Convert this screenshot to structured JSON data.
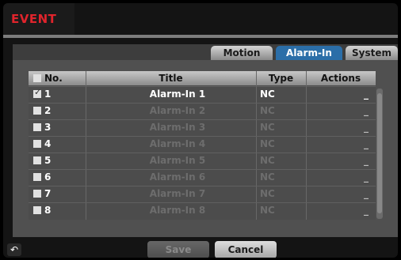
{
  "window": {
    "title": "EVENT"
  },
  "tabs": [
    {
      "label": "Motion"
    },
    {
      "label": "Alarm-In"
    },
    {
      "label": "System"
    }
  ],
  "table": {
    "headers": {
      "no": "No.",
      "title": "Title",
      "type": "Type",
      "actions": "Actions"
    },
    "rows": [
      {
        "no": "1",
        "title": "Alarm-In 1",
        "type": "NC"
      },
      {
        "no": "2",
        "title": "Alarm-In 2",
        "type": "NC"
      },
      {
        "no": "3",
        "title": "Alarm-In 3",
        "type": "NC"
      },
      {
        "no": "4",
        "title": "Alarm-In 4",
        "type": "NC"
      },
      {
        "no": "5",
        "title": "Alarm-In 5",
        "type": "NC"
      },
      {
        "no": "6",
        "title": "Alarm-In 6",
        "type": "NC"
      },
      {
        "no": "7",
        "title": "Alarm-In 7",
        "type": "NC"
      },
      {
        "no": "8",
        "title": "Alarm-In 8",
        "type": "NC"
      }
    ]
  },
  "buttons": {
    "save": "Save",
    "cancel": "Cancel"
  },
  "colors": {
    "accent": "#2b6ea8",
    "title": "#e0242c"
  },
  "icons": {
    "back": "back-icon",
    "dropdown": "dropdown-icon"
  }
}
